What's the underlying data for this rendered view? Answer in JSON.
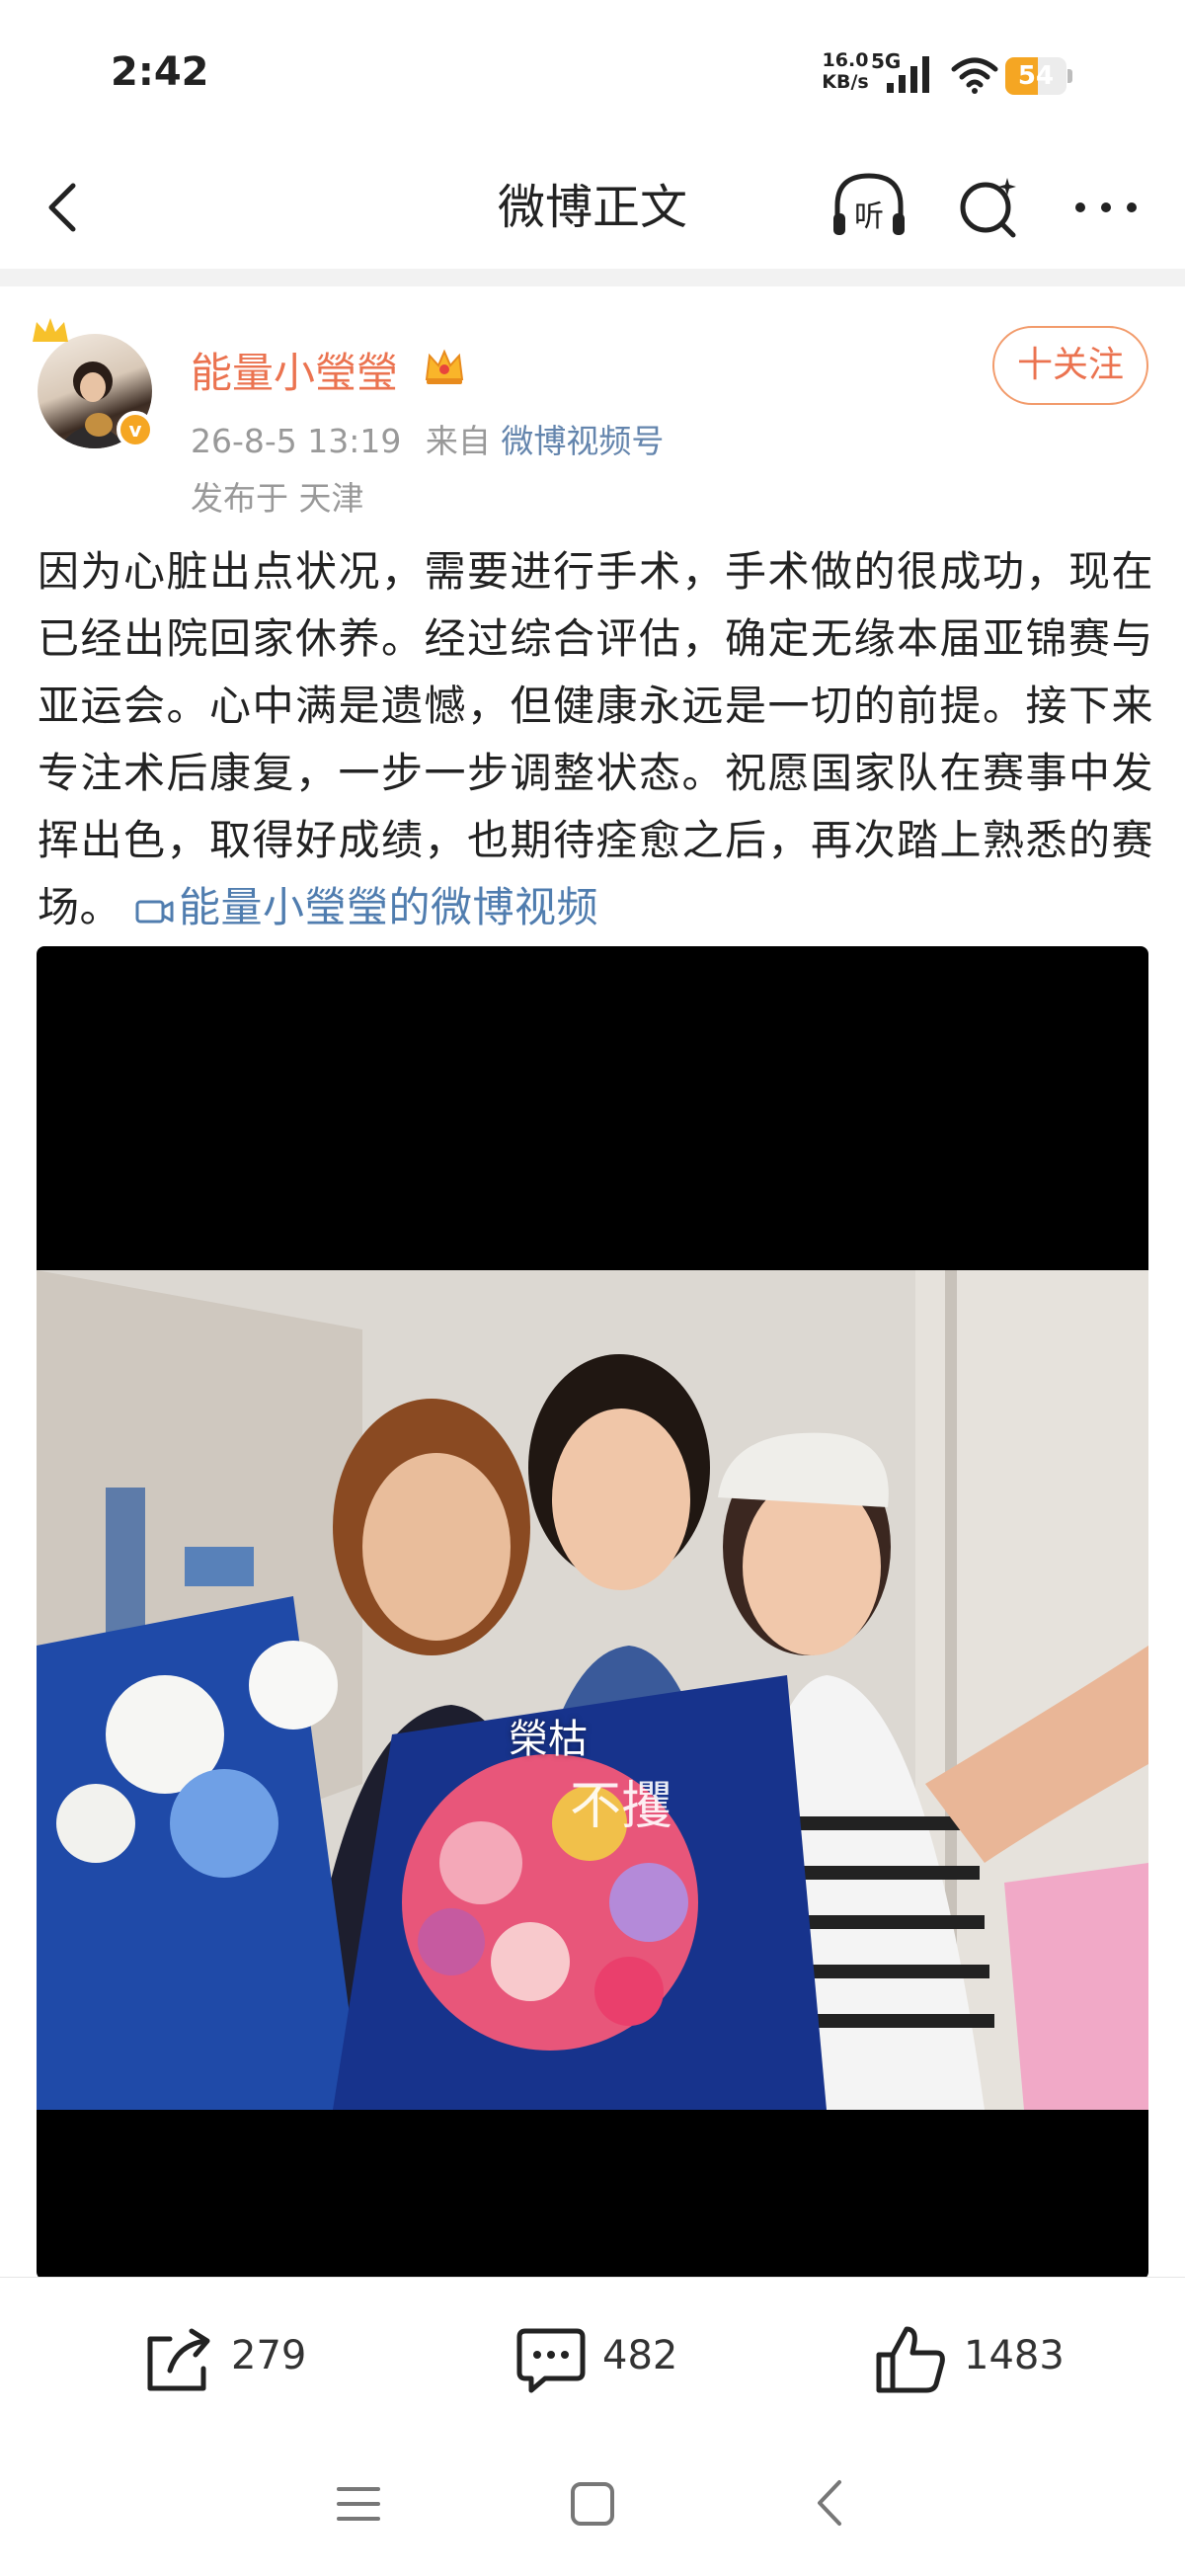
{
  "status_bar": {
    "time": "2:42",
    "net_speed_value": "16.0",
    "net_speed_unit": "KB/s",
    "network": "5G",
    "battery_level": "54",
    "battery_fraction": 0.54,
    "battery_color": "#f5a623"
  },
  "header": {
    "title": "微博正文",
    "back_icon": "chevron-left-icon",
    "listen_label": "听",
    "search_icon": "search-sparkle-icon",
    "more_icon": "more-dots-icon"
  },
  "post": {
    "author_name": "能量小瑩瑩",
    "verified_mark": "v",
    "timestamp": "26-8-5 13:19",
    "source_prefix": "来自",
    "source": "微博视频号",
    "location_prefix": "发布于",
    "location": "天津",
    "follow_label": "十关注",
    "text": "因为心脏出点状况，需要进行手术，手术做的很成功，现在已经出院回家休养。经过综合评估，确定无缘本届亚锦赛与亚运会。心中满是遗憾，但健康永远是一切的前提。接下来专注术后康复，一步一步调整状态。祝愿国家队在赛事中发挥出色，取得好成绩，也期待痊愈之后，再次踏上熟悉的赛场。",
    "video_link": "能量小瑩瑩的微博视频",
    "name_color": "#eb7350",
    "link_color": "#507daf"
  },
  "video": {
    "caption_line1": "榮枯",
    "caption_line2": "不攫"
  },
  "actions": {
    "reposts": "279",
    "comments": "482",
    "likes": "1483"
  }
}
